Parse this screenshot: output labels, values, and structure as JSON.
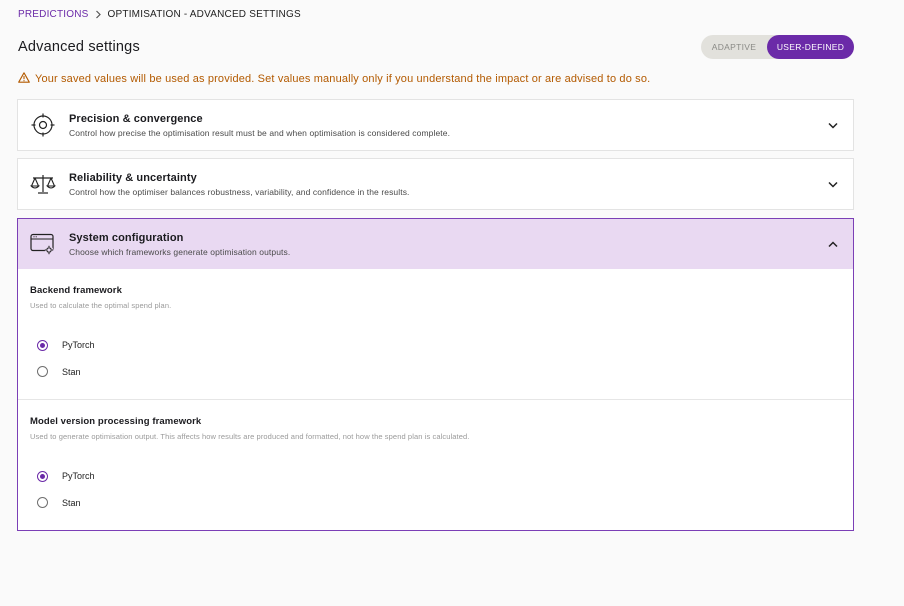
{
  "breadcrumb": {
    "root": "PREDICTIONS",
    "current": "OPTIMISATION - ADVANCED SETTINGS"
  },
  "page_title": "Advanced settings",
  "mode_toggle": {
    "adaptive": "ADAPTIVE",
    "user_defined": "USER-DEFINED",
    "selected": "USER-DEFINED"
  },
  "warning": "Your saved values will be used as provided. Set values manually only if you understand the impact or are advised to do so.",
  "panels": [
    {
      "title": "Precision & convergence",
      "subtitle": "Control how precise the optimisation result must be and when optimisation is considered complete.",
      "icon": "target-icon",
      "expanded": false
    },
    {
      "title": "Reliability & uncertainty",
      "subtitle": "Control how the optimiser balances robustness, variability, and confidence in the results.",
      "icon": "scale-icon",
      "expanded": false
    },
    {
      "title": "System configuration",
      "subtitle": "Choose which frameworks generate optimisation outputs.",
      "icon": "window-gear-icon",
      "expanded": true,
      "sections": [
        {
          "title": "Backend framework",
          "help": "Used to calculate the optimal spend plan.",
          "options": [
            "PyTorch",
            "Stan"
          ],
          "selected": "PyTorch"
        },
        {
          "title": "Model version processing framework",
          "help": "Used to generate optimisation output. This affects how results are produced and formatted, not how the spend plan is calculated.",
          "options": [
            "PyTorch",
            "Stan"
          ],
          "selected": "PyTorch"
        }
      ]
    }
  ],
  "colors": {
    "accent": "#6b2aa8",
    "warning": "#b35a00",
    "expanded_header": "#e9d9f2"
  }
}
